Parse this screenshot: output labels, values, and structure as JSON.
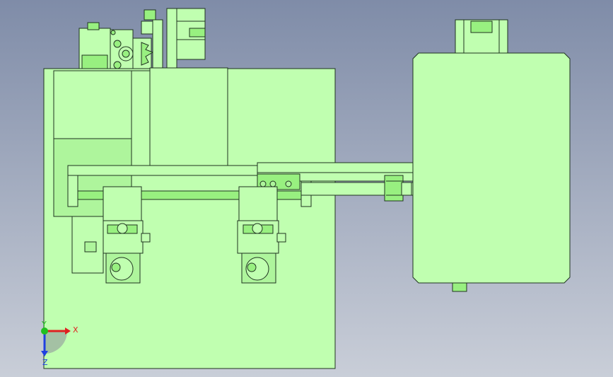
{
  "viewport": {
    "background_top": "#7f8ca8",
    "background_bottom": "#c9ced8"
  },
  "colors": {
    "part_fill": "#c0ffb0",
    "part_fill_dark": "#98f080",
    "part_fill_mid": "#aef59c",
    "edge": "#1f3320",
    "axis_x": "#e02020",
    "axis_y": "#20c020",
    "axis_z": "#2040e0"
  },
  "triad": {
    "x_label": "X",
    "y_label": "Y",
    "z_label": "Z",
    "x_icon": "x-axis-arrow-icon",
    "y_icon": "y-axis-dot-icon",
    "z_icon": "z-axis-arrow-icon"
  },
  "parts": {
    "base_plate": "base-plate",
    "right_housing": "right-housing",
    "motor": "top-motor",
    "gear": "gear",
    "guide_rail": "guide-rail",
    "carriage_left": "carriage-left",
    "carriage_right": "carriage-right",
    "extension_arm": "extension-arm",
    "roller": "roller"
  }
}
